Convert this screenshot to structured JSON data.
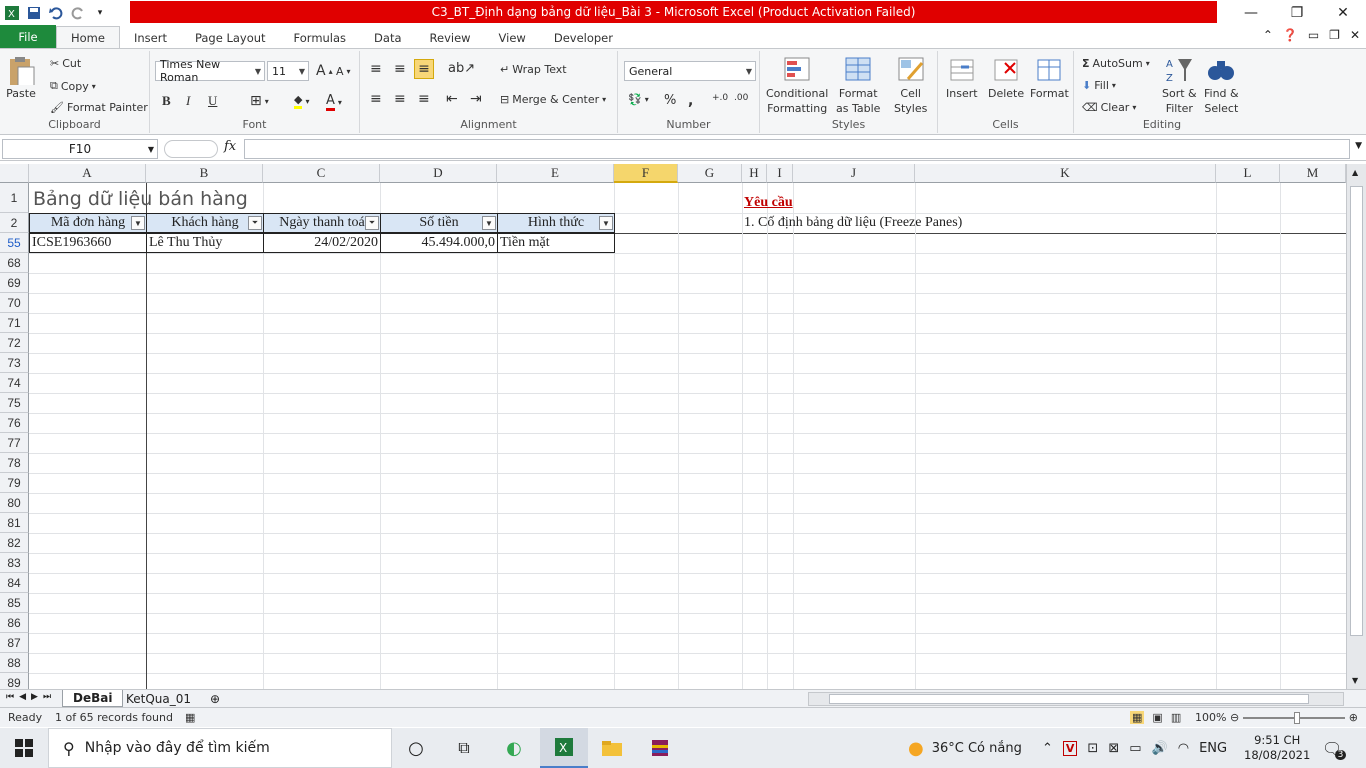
{
  "window": {
    "title": "C3_BT_Định dạng bảng dữ liệu_Bài 3  -  Microsoft Excel (Product Activation Failed)"
  },
  "tabs": [
    "File",
    "Home",
    "Insert",
    "Page Layout",
    "Formulas",
    "Data",
    "Review",
    "View",
    "Developer"
  ],
  "ribbon": {
    "clipboard": {
      "label": "Clipboard",
      "paste": "Paste",
      "cut": "Cut",
      "copy": "Copy",
      "format_painter": "Format Painter"
    },
    "font": {
      "label": "Font",
      "name": "Times New Roman",
      "size": "11",
      "bold": "B",
      "italic": "I",
      "underline": "U"
    },
    "alignment": {
      "label": "Alignment",
      "wrap": "Wrap Text",
      "merge": "Merge & Center"
    },
    "number": {
      "label": "Number",
      "format": "General",
      "percent": "%",
      "comma": ","
    },
    "styles": {
      "label": "Styles",
      "conditional": "Conditional",
      "conditional2": "Formatting",
      "format_table": "Format",
      "format_table2": "as Table",
      "cell_styles": "Cell",
      "cell_styles2": "Styles"
    },
    "cells": {
      "label": "Cells",
      "insert": "Insert",
      "delete": "Delete",
      "format": "Format"
    },
    "editing": {
      "label": "Editing",
      "autosum": "AutoSum",
      "fill": "Fill",
      "clear": "Clear",
      "sort": "Sort &",
      "sort2": "Filter",
      "find": "Find &",
      "find2": "Select"
    }
  },
  "formula_bar": {
    "name_box": "F10",
    "fx": "fx",
    "value": ""
  },
  "columns": [
    "A",
    "B",
    "C",
    "D",
    "E",
    "F",
    "G",
    "H",
    "I",
    "J",
    "K",
    "L",
    "M"
  ],
  "rows": [
    "1",
    "2",
    "55",
    "68",
    "69",
    "70",
    "71",
    "72",
    "73",
    "74",
    "75",
    "76",
    "77",
    "78",
    "79",
    "80",
    "81",
    "82",
    "83",
    "84",
    "85",
    "86",
    "87",
    "88",
    "89"
  ],
  "sheet": {
    "title": "Bảng dữ liệu bán hàng",
    "headers": [
      "Mã đơn hàng",
      "Khách hàng",
      "Ngày thanh toá",
      "Số tiền",
      "Hình thức"
    ],
    "row55": [
      "ICSE1963660",
      "Lê Thu Thủy",
      "24/02/2020",
      "45.494.000,0",
      "Tiền mặt"
    ],
    "requirement_title": "Yêu cầu",
    "requirement_1": "1. Cố định bảng dữ liệu (Freeze Panes)"
  },
  "sheet_tabs": [
    "DeBai",
    "KetQua_01"
  ],
  "status": {
    "ready": "Ready",
    "records": "1 of 65 records found",
    "zoom": "100%"
  },
  "taskbar": {
    "search_placeholder": "Nhập vào đây để tìm kiếm",
    "weather": "36°C  Có nắng",
    "lang": "ENG",
    "time": "9:51 CH",
    "date": "18/08/2021",
    "notif": "3"
  },
  "colors": {
    "title_bar": "#e00000",
    "file_tab": "#1e8a3c",
    "selected_col": "#f5d66c",
    "header_fill": "#d9e6f5",
    "requirement": "#c00000"
  }
}
